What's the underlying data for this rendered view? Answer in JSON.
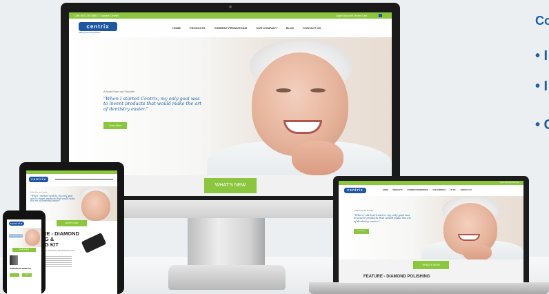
{
  "side_panel": {
    "heading": "Co",
    "bullets": [
      "• I",
      "• I",
      "• C"
    ]
  },
  "monitor": {
    "topbar_left": "Call: 800.235.5862 | Contact Centrix",
    "topbar_right": "Login   Account   Order   Cart",
    "logo": "centrix",
    "logo_tag": "Making Dentistry Easier",
    "nav_items": [
      "HOME",
      "PRODUCTS",
      "CURRENT PROMOTIONS",
      "OUR COMPANY",
      "BLOG",
      "CONTACT US"
    ],
    "hero_small": "A Note From our Founder",
    "quote": "\"When I started Centrix, my only goal was to invent products that would make the art of dentistry easier.\"",
    "button": "Learn More",
    "whats_new": "WHAT'S NEW"
  },
  "laptop": {
    "topbar_right": "Login   Account   Order   Cart",
    "logo": "centrix",
    "nav_items": [
      "HOME",
      "PRODUCTS",
      "CURRENT PROMOTIONS",
      "OUR COMPANY",
      "BLOG",
      "CONTACT US"
    ],
    "hero_small": "A Note From our Founder",
    "quote": "\"When I started Centrix, my only goal was to invent products that would make the art of dentistry easier.\"",
    "button": "Learn More",
    "whats_new": "WHAT'S NEW",
    "feature": "FEATURE - DIAMOND POLISHING"
  },
  "tablet": {
    "logo": "centrix",
    "hero_small": "A Note From our Founder",
    "quote": "\"When I started Centrix, my only goal was to invent products that would make the art of dentistry easier.\"",
    "whats_new": "WHAT'S NEW",
    "feature_title": "TURE - DIAMOND\nHING &\nHING KIT",
    "feature_sub": "Composites, Ceramics, Zirconia and more"
  },
  "phone": {
    "logo": "centrix",
    "button": "WHAT'S NEW",
    "product_text": "DIAMOND POLISHING KIT",
    "btn_a": "",
    "btn_b": "learn"
  },
  "colors": {
    "brand_blue": "#1f56a2",
    "accent_green": "#8cc63f",
    "heading_blue": "#1b5fa5"
  }
}
